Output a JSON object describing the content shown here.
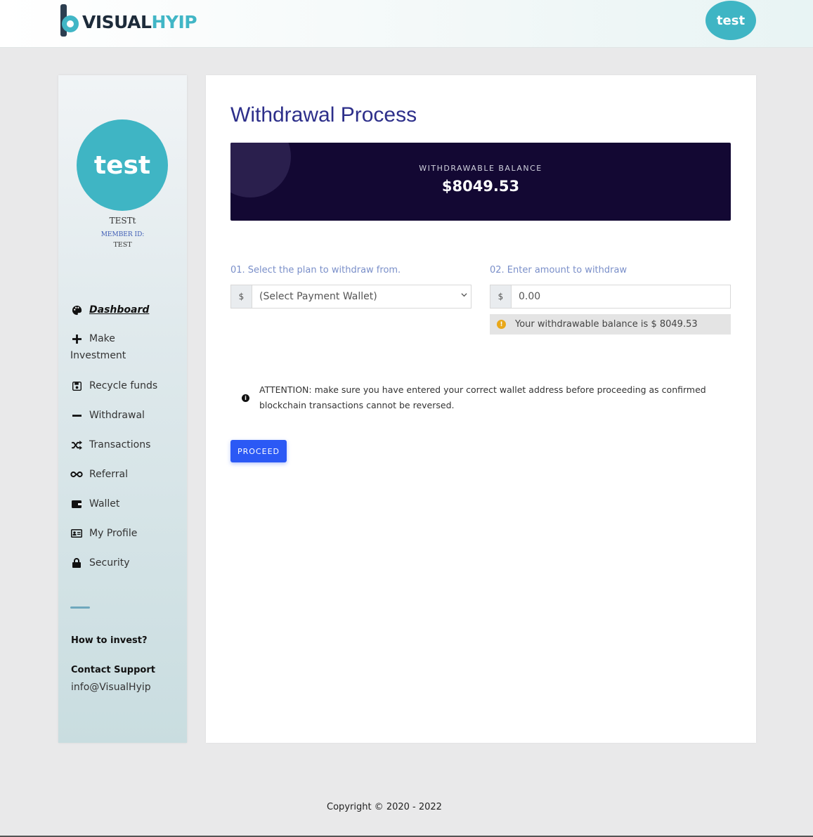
{
  "header": {
    "logo_part1": "VISUAL",
    "logo_part2": "HYIP",
    "avatar_label": "test"
  },
  "sidebar": {
    "avatar_label": "test",
    "username": "TESTt",
    "member_id_label": "MEMBER ID:",
    "member_id": "TEST",
    "items": [
      {
        "label": "Dashboard",
        "icon": "palette-icon"
      },
      {
        "label": "Make Investment",
        "icon": "plus-icon"
      },
      {
        "label": "Recycle funds",
        "icon": "save-icon"
      },
      {
        "label": "Withdrawal",
        "icon": "minus-icon"
      },
      {
        "label": "Transactions",
        "icon": "shuffle-icon"
      },
      {
        "label": "Referral",
        "icon": "infinity-icon"
      },
      {
        "label": "Wallet",
        "icon": "wallet-icon"
      },
      {
        "label": "My Profile",
        "icon": "id-card-icon"
      },
      {
        "label": "Security",
        "icon": "lock-icon"
      }
    ],
    "help_link": "How to invest?",
    "contact_title": "Contact Support",
    "contact_email": "info@VisualHyip"
  },
  "main": {
    "title": "Withdrawal Process",
    "balance_label": "WITHDRAWABLE BALANCE",
    "balance_value": "$8049.53",
    "plan_label": "01. Select the plan to withdraw from.",
    "currency_symbol": "$",
    "plan_select_value": "(Select Payment Wallet)",
    "amount_label": "02. Enter amount to withdraw",
    "amount_value": "0.00",
    "balance_hint": "Your withdrawable balance is $ 8049.53",
    "attention_text": "ATTENTION: make sure you have entered your correct wallet address before proceeding as confirmed blockchain transactions cannot be reversed.",
    "proceed_label": "PROCEED"
  },
  "footer": {
    "copyright": "Copyright © 2020 - 2022"
  },
  "colors": {
    "accent": "#3fb5c4",
    "title": "#2d2f8a",
    "balance_card": "#130833",
    "button": "#2b59f5",
    "warning": "#e9a81a"
  }
}
